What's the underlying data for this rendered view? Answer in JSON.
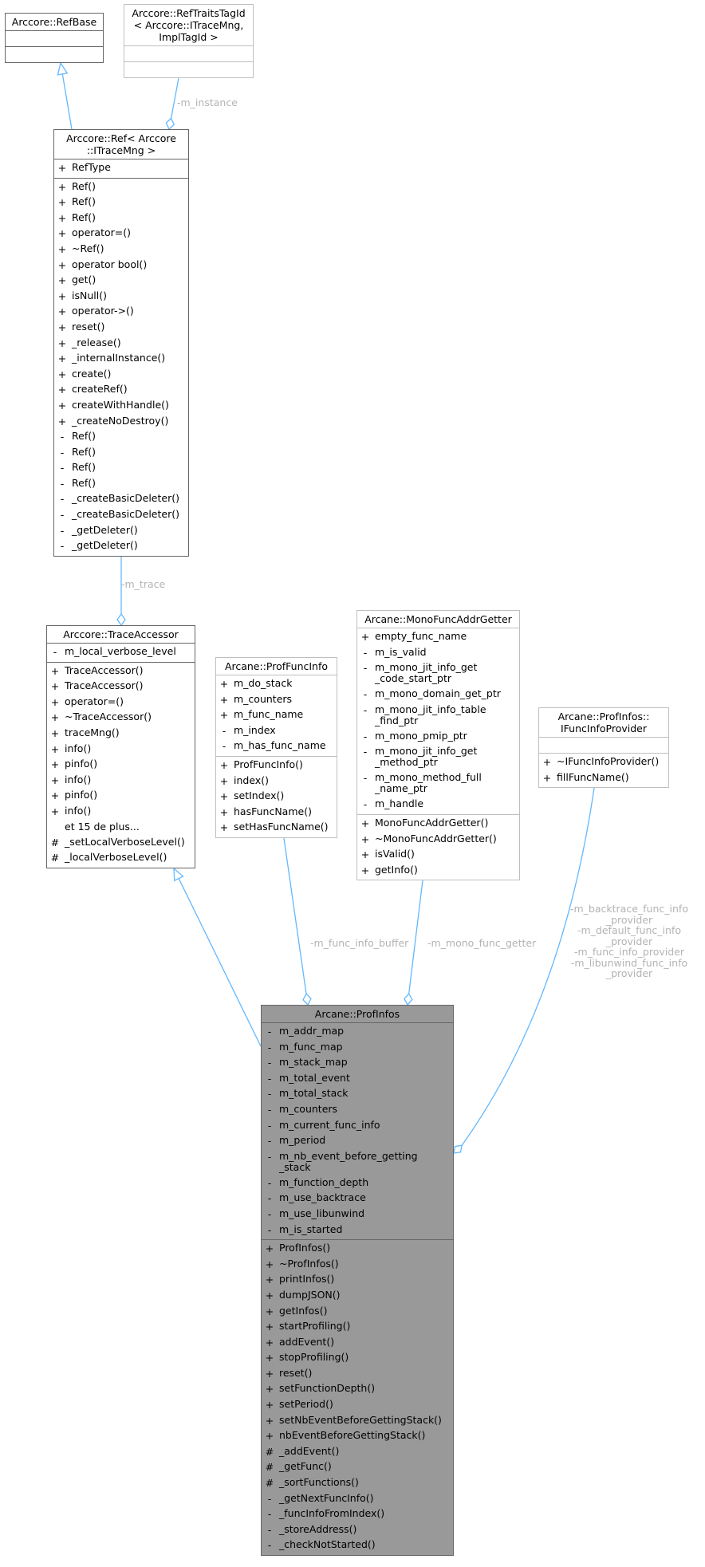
{
  "diagram": {
    "type": "uml-class-collaboration",
    "edge_color": "#63b8ff",
    "focus_fill": "#999999",
    "nodes": {
      "refbase": {
        "title": "Arccore::RefBase",
        "attributes": [],
        "methods": []
      },
      "reftraits": {
        "title": "Arccore::RefTraitsTagId\n< Arccore::ITraceMng,\nImplTagId >",
        "attributes": [],
        "methods": []
      },
      "ref": {
        "title": "Arccore::Ref< Arccore\n::ITraceMng >",
        "attributes": [
          {
            "vis": "+",
            "name": "RefType"
          }
        ],
        "methods": [
          {
            "vis": "+",
            "name": "Ref()"
          },
          {
            "vis": "+",
            "name": "Ref()"
          },
          {
            "vis": "+",
            "name": "Ref()"
          },
          {
            "vis": "+",
            "name": "operator=()"
          },
          {
            "vis": "+",
            "name": "~Ref()"
          },
          {
            "vis": "+",
            "name": "operator bool()"
          },
          {
            "vis": "+",
            "name": "get()"
          },
          {
            "vis": "+",
            "name": "isNull()"
          },
          {
            "vis": "+",
            "name": "operator->()"
          },
          {
            "vis": "+",
            "name": "reset()"
          },
          {
            "vis": "+",
            "name": "_release()"
          },
          {
            "vis": "+",
            "name": "_internalInstance()"
          },
          {
            "vis": "+",
            "name": "create()"
          },
          {
            "vis": "+",
            "name": "createRef()"
          },
          {
            "vis": "+",
            "name": "createWithHandle()"
          },
          {
            "vis": "+",
            "name": "_createNoDestroy()"
          },
          {
            "vis": "-",
            "name": "Ref()"
          },
          {
            "vis": "-",
            "name": "Ref()"
          },
          {
            "vis": "-",
            "name": "Ref()"
          },
          {
            "vis": "-",
            "name": "Ref()"
          },
          {
            "vis": "-",
            "name": "_createBasicDeleter()"
          },
          {
            "vis": "-",
            "name": "_createBasicDeleter()"
          },
          {
            "vis": "-",
            "name": "_getDeleter()"
          },
          {
            "vis": "-",
            "name": "_getDeleter()"
          }
        ]
      },
      "traceaccessor": {
        "title": "Arccore::TraceAccessor",
        "attributes": [
          {
            "vis": "-",
            "name": "m_local_verbose_level"
          }
        ],
        "methods": [
          {
            "vis": "+",
            "name": "TraceAccessor()"
          },
          {
            "vis": "+",
            "name": "TraceAccessor()"
          },
          {
            "vis": "+",
            "name": "operator=()"
          },
          {
            "vis": "+",
            "name": "~TraceAccessor()"
          },
          {
            "vis": "+",
            "name": "traceMng()"
          },
          {
            "vis": "+",
            "name": "info()"
          },
          {
            "vis": "+",
            "name": "pinfo()"
          },
          {
            "vis": "+",
            "name": "info()"
          },
          {
            "vis": "+",
            "name": "pinfo()"
          },
          {
            "vis": "+",
            "name": "info()"
          },
          {
            "vis": "",
            "name": "et 15 de plus..."
          },
          {
            "vis": "#",
            "name": "_setLocalVerboseLevel()"
          },
          {
            "vis": "#",
            "name": "_localVerboseLevel()"
          }
        ]
      },
      "proffuncinfo": {
        "title": "Arcane::ProfFuncInfo",
        "attributes": [
          {
            "vis": "+",
            "name": "m_do_stack"
          },
          {
            "vis": "+",
            "name": "m_counters"
          },
          {
            "vis": "+",
            "name": "m_func_name"
          },
          {
            "vis": "-",
            "name": "m_index"
          },
          {
            "vis": "-",
            "name": "m_has_func_name"
          }
        ],
        "methods": [
          {
            "vis": "+",
            "name": "ProfFuncInfo()"
          },
          {
            "vis": "+",
            "name": "index()"
          },
          {
            "vis": "+",
            "name": "setIndex()"
          },
          {
            "vis": "+",
            "name": "hasFuncName()"
          },
          {
            "vis": "+",
            "name": "setHasFuncName()"
          }
        ]
      },
      "monofunc": {
        "title": "Arcane::MonoFuncAddrGetter",
        "attributes": [
          {
            "vis": "+",
            "name": "empty_func_name"
          },
          {
            "vis": "-",
            "name": "m_is_valid"
          },
          {
            "vis": "-",
            "name": "m_mono_jit_info_get\n_code_start_ptr"
          },
          {
            "vis": "-",
            "name": "m_mono_domain_get_ptr"
          },
          {
            "vis": "-",
            "name": "m_mono_jit_info_table\n_find_ptr"
          },
          {
            "vis": "-",
            "name": "m_mono_pmip_ptr"
          },
          {
            "vis": "-",
            "name": "m_mono_jit_info_get\n_method_ptr"
          },
          {
            "vis": "-",
            "name": "m_mono_method_full\n_name_ptr"
          },
          {
            "vis": "-",
            "name": "m_handle"
          }
        ],
        "methods": [
          {
            "vis": "+",
            "name": "MonoFuncAddrGetter()"
          },
          {
            "vis": "+",
            "name": "~MonoFuncAddrGetter()"
          },
          {
            "vis": "+",
            "name": "isValid()"
          },
          {
            "vis": "+",
            "name": "getInfo()"
          }
        ]
      },
      "ifuncinfo": {
        "title": "Arcane::ProfInfos::\nIFuncInfoProvider",
        "attributes": [],
        "methods": [
          {
            "vis": "+",
            "name": "~IFuncInfoProvider()"
          },
          {
            "vis": "+",
            "name": "fillFuncName()"
          }
        ]
      },
      "profinfos": {
        "title": "Arcane::ProfInfos",
        "attributes": [
          {
            "vis": "-",
            "name": "m_addr_map"
          },
          {
            "vis": "-",
            "name": "m_func_map"
          },
          {
            "vis": "-",
            "name": "m_stack_map"
          },
          {
            "vis": "-",
            "name": "m_total_event"
          },
          {
            "vis": "-",
            "name": "m_total_stack"
          },
          {
            "vis": "-",
            "name": "m_counters"
          },
          {
            "vis": "-",
            "name": "m_current_func_info"
          },
          {
            "vis": "-",
            "name": "m_period"
          },
          {
            "vis": "-",
            "name": "m_nb_event_before_getting\n_stack"
          },
          {
            "vis": "-",
            "name": "m_function_depth"
          },
          {
            "vis": "-",
            "name": "m_use_backtrace"
          },
          {
            "vis": "-",
            "name": "m_use_libunwind"
          },
          {
            "vis": "-",
            "name": "m_is_started"
          }
        ],
        "methods": [
          {
            "vis": "+",
            "name": "ProfInfos()"
          },
          {
            "vis": "+",
            "name": "~ProfInfos()"
          },
          {
            "vis": "+",
            "name": "printInfos()"
          },
          {
            "vis": "+",
            "name": "dumpJSON()"
          },
          {
            "vis": "+",
            "name": "getInfos()"
          },
          {
            "vis": "+",
            "name": "startProfiling()"
          },
          {
            "vis": "+",
            "name": "addEvent()"
          },
          {
            "vis": "+",
            "name": "stopProfiling()"
          },
          {
            "vis": "+",
            "name": "reset()"
          },
          {
            "vis": "+",
            "name": "setFunctionDepth()"
          },
          {
            "vis": "+",
            "name": "setPeriod()"
          },
          {
            "vis": "+",
            "name": "setNbEventBeforeGettingStack()"
          },
          {
            "vis": "+",
            "name": "nbEventBeforeGettingStack()"
          },
          {
            "vis": "#",
            "name": "_addEvent()"
          },
          {
            "vis": "#",
            "name": "_getFunc()"
          },
          {
            "vis": "#",
            "name": "_sortFunctions()"
          },
          {
            "vis": "-",
            "name": "_getNextFuncInfo()"
          },
          {
            "vis": "-",
            "name": "_funcInfoFromIndex()"
          },
          {
            "vis": "-",
            "name": "_storeAddress()"
          },
          {
            "vis": "-",
            "name": "_checkNotStarted()"
          }
        ]
      }
    },
    "edges": [
      {
        "from": "ref",
        "to": "refbase",
        "kind": "inheritance",
        "label": ""
      },
      {
        "from": "reftraits",
        "to": "ref",
        "kind": "aggregation",
        "label": "-m_instance"
      },
      {
        "from": "ref",
        "to": "traceaccessor",
        "kind": "aggregation",
        "label": "-m_trace"
      },
      {
        "from": "profinfos",
        "to": "traceaccessor",
        "kind": "inheritance",
        "label": ""
      },
      {
        "from": "proffuncinfo",
        "to": "profinfos",
        "kind": "aggregation",
        "label": "-m_func_info_buffer"
      },
      {
        "from": "monofunc",
        "to": "profinfos",
        "kind": "aggregation",
        "label": "-m_mono_func_getter"
      },
      {
        "from": "ifuncinfo",
        "to": "profinfos",
        "kind": "aggregation",
        "label": "-m_backtrace_func_info\n_provider\n-m_default_func_info\n_provider\n-m_func_info_provider\n-m_libunwind_func_info\n_provider"
      }
    ]
  }
}
